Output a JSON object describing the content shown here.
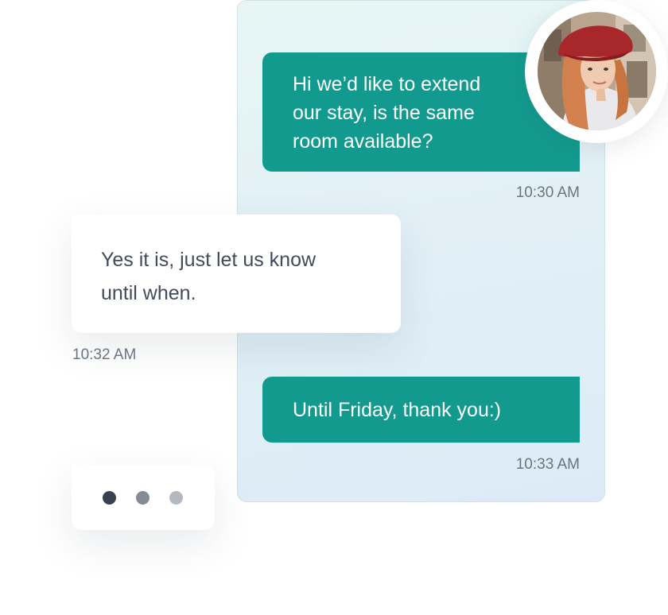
{
  "conversation": {
    "messages": [
      {
        "direction": "outgoing",
        "lines": [
          "Hi we’d like to extend",
          "our stay, is the same",
          "room available?"
        ],
        "time": "10:30 AM"
      },
      {
        "direction": "incoming",
        "lines": [
          "Yes it is, just let us know",
          "until when."
        ],
        "time": "10:32 AM"
      },
      {
        "direction": "outgoing",
        "lines": [
          "Until Friday, thank you:)"
        ],
        "time": "10:33 AM"
      }
    ],
    "typing_indicator": {
      "dot_colors": [
        "#394150",
        "#858c96",
        "#b4b9bf"
      ]
    },
    "avatar": {
      "icon": "user-avatar-photo"
    }
  },
  "colors": {
    "outgoing_bubble": "#139a8e",
    "incoming_bubble": "#ffffff",
    "timestamp": "#6b7482",
    "incoming_text": "#434a59",
    "panel_background": "#e4f3f5"
  }
}
